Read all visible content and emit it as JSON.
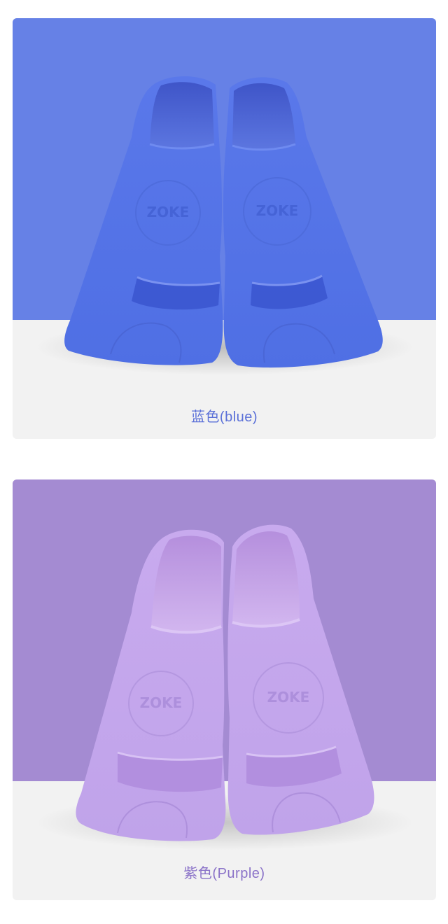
{
  "products": [
    {
      "caption": "蓝色(blue)",
      "brand_logo": "ZOKE",
      "colors": {
        "background": "#6681e6",
        "fin": "#5b78e8",
        "fin_dark": "#3f5fd6",
        "fin_light": "#7a92f0",
        "caption": "#5b70d8"
      }
    },
    {
      "caption": "紫色(Purple)",
      "brand_logo": "ZOKE",
      "colors": {
        "background": "#a48bd2",
        "fin": "#c3a6ec",
        "fin_dark": "#a98bd8",
        "fin_light": "#d6bff3",
        "caption": "#8a72c8"
      }
    }
  ]
}
